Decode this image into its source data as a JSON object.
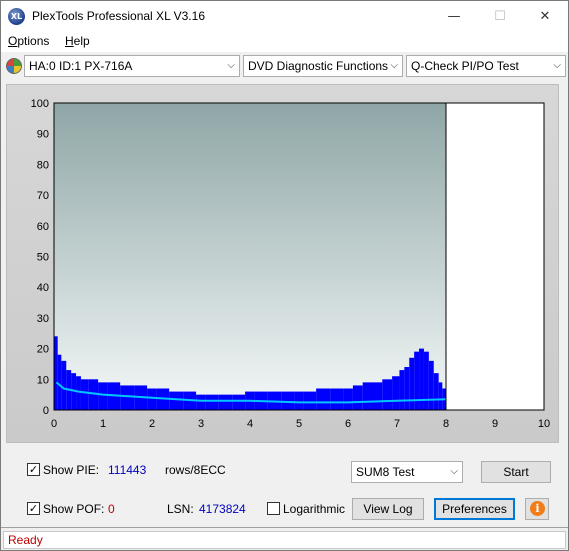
{
  "window": {
    "title": "PlexTools Professional XL V3.16",
    "app_icon_text": "XL"
  },
  "window_controls": {
    "minimize": "—",
    "maximize": "☐",
    "close": "✕"
  },
  "menu": {
    "options": "Options",
    "options_accel": "O",
    "options_rest": "ptions",
    "help_accel": "H",
    "help_rest": "elp"
  },
  "toolbar": {
    "drive": "HA:0 ID:1  PX-716A",
    "function": "DVD Diagnostic Functions",
    "test": "Q-Check PI/PO Test",
    "arrow": "⌵"
  },
  "chart_data": {
    "type": "area",
    "xlim": [
      0,
      10
    ],
    "ylim": [
      0,
      100
    ],
    "x_ticks": [
      "0",
      "1",
      "2",
      "3",
      "4",
      "5",
      "6",
      "7",
      "8",
      "9",
      "10"
    ],
    "y_ticks": [
      "0",
      "10",
      "20",
      "30",
      "40",
      "50",
      "60",
      "70",
      "80",
      "90",
      "100"
    ],
    "grid": false,
    "scan_end_x": 8.0,
    "colors": {
      "bars": "#0000ff",
      "average_line": "#00c8ff",
      "plot_top": "#8fa6a6",
      "plot_bottom": "#f4f8f8"
    },
    "series": [
      {
        "kind": "bars",
        "x": [
          0.05,
          0.1,
          0.2,
          0.3,
          0.4,
          0.5,
          0.6,
          0.8,
          1.0,
          1.2,
          1.5,
          1.8,
          2.0,
          2.2,
          2.5,
          2.8,
          3.0,
          3.2,
          3.5,
          3.8,
          4.0,
          4.2,
          4.5,
          4.8,
          5.0,
          5.2,
          5.5,
          5.8,
          6.0,
          6.2,
          6.4,
          6.6,
          6.8,
          7.0,
          7.1,
          7.2,
          7.3,
          7.4,
          7.5,
          7.6,
          7.7,
          7.8,
          7.9,
          7.95
        ],
        "values": [
          24,
          18,
          16,
          13,
          12,
          11,
          10,
          10,
          9,
          9,
          8,
          8,
          7,
          7,
          6,
          6,
          5,
          5,
          5,
          5,
          6,
          6,
          6,
          6,
          6,
          6,
          7,
          7,
          7,
          8,
          9,
          9,
          10,
          11,
          13,
          14,
          17,
          19,
          20,
          19,
          16,
          12,
          9,
          7
        ]
      },
      {
        "kind": "average_line",
        "x": [
          0.05,
          0.2,
          0.5,
          1.0,
          2.0,
          3.0,
          4.0,
          5.0,
          6.0,
          7.0,
          8.0
        ],
        "values": [
          9,
          7,
          6,
          5,
          4,
          3,
          3,
          2.5,
          2.5,
          3,
          3.5
        ]
      }
    ]
  },
  "controls": {
    "show_pie_label": "Show PIE:",
    "show_pie_checked": "✓",
    "pie_value": "111443",
    "pie_unit": "rows/8ECC",
    "show_pof_label": "Show POF:",
    "show_pof_checked": "✓",
    "pof_value": "0",
    "lsn_label": "LSN:",
    "lsn_value": "4173824",
    "logarithmic_label": "Logarithmic",
    "logarithmic_checked": "",
    "test_select": "SUM8 Test",
    "start_button": "Start",
    "view_log_button": "View Log",
    "preferences_button": "Preferences",
    "info_glyph": "i"
  },
  "status": {
    "text": "Ready"
  }
}
